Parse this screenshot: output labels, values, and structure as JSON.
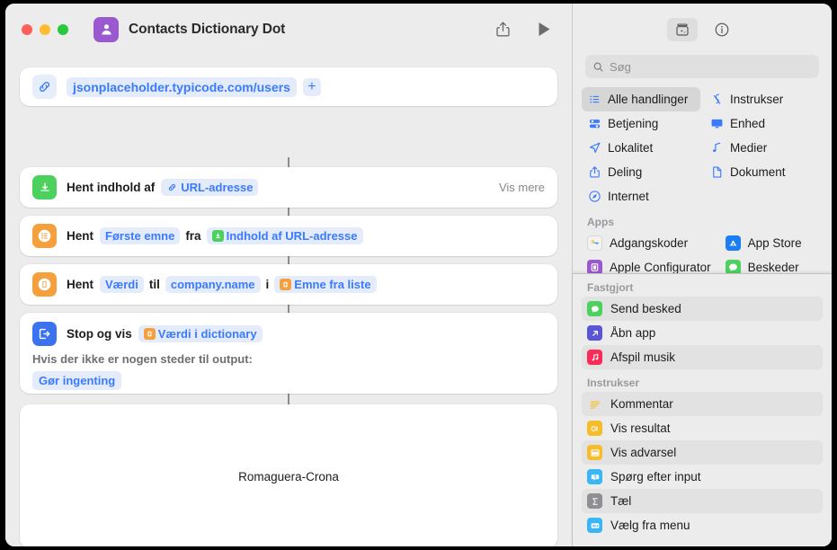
{
  "window": {
    "title": "Contacts Dictionary Dot",
    "app_icon": "contacts-person-icon",
    "traffic_lights": [
      "close",
      "minimize",
      "zoom"
    ],
    "toolbar": {
      "share_label": "share-icon",
      "run_label": "play-icon"
    }
  },
  "editor": {
    "url_action": {
      "icon": "link-icon",
      "url": "jsonplaceholder.typicode.com/users",
      "add_label": "+"
    },
    "actions": [
      {
        "icon": "download-content-icon",
        "title": "Hent indhold af",
        "token": "URL-adresse",
        "token_icon": "link-icon",
        "trailing": "Vis mere"
      },
      {
        "icon": "list-icon",
        "title": "Hent",
        "param1": "Første emne",
        "connector": "fra",
        "token": "Indhold af URL-adresse",
        "token_icon": "download-content-icon"
      },
      {
        "icon": "dictionary-icon",
        "title": "Hent",
        "param1": "Værdi",
        "connector1": "til",
        "param2": "company.name",
        "connector2": "i",
        "token": "Emne fra liste",
        "token_icon": "dictionary-icon"
      }
    ],
    "stop_action": {
      "icon": "stop-and-output-icon",
      "title": "Stop og vis",
      "token": "Værdi i dictionary",
      "token_icon": "dictionary-icon",
      "sub_label": "Hvis der ikke er nogen steder til output:",
      "sub_value": "Gør ingenting"
    },
    "result": {
      "text": "Romaguera-Crona"
    }
  },
  "sidebar": {
    "toolbar": {
      "library_icon": "action-library-icon",
      "info_icon": "info-circle-icon"
    },
    "search": {
      "placeholder": "Søg",
      "value": "",
      "icon": "search-icon"
    },
    "categories": [
      {
        "label": "Alle handlinger",
        "icon": "list-bullet-icon",
        "selected": true
      },
      {
        "label": "Instrukser",
        "icon": "scripting-icon",
        "selected": false
      },
      {
        "label": "Betjening",
        "icon": "controls-icon",
        "selected": false
      },
      {
        "label": "Enhed",
        "icon": "display-icon",
        "selected": false
      },
      {
        "label": "Lokalitet",
        "icon": "location-arrow-icon",
        "selected": false
      },
      {
        "label": "Medier",
        "icon": "music-note-icon",
        "selected": false
      },
      {
        "label": "Deling",
        "icon": "share-icon",
        "selected": false
      },
      {
        "label": "Dokument",
        "icon": "document-icon",
        "selected": false
      },
      {
        "label": "Internet",
        "icon": "safari-compass-icon",
        "selected": false
      }
    ],
    "apps_header": "Apps",
    "apps": [
      {
        "label": "Adgangskoder",
        "icon": "passwords-app-icon"
      },
      {
        "label": "App Store",
        "icon": "app-store-icon"
      },
      {
        "label": "Apple Configurator",
        "icon": "apple-configurator-icon"
      },
      {
        "label": "Beskeder",
        "icon": "messages-app-icon"
      }
    ],
    "pinned_header": "Fastgjort",
    "pinned": [
      {
        "label": "Send besked",
        "icon": "messages-app-icon",
        "color": "#4cd15f",
        "alt": true
      },
      {
        "label": "Åbn app",
        "icon": "open-app-icon",
        "color": "#5856d6",
        "alt": false
      },
      {
        "label": "Afspil musik",
        "icon": "music-app-icon",
        "color": "#fa2b56",
        "alt": true
      }
    ],
    "scripting_header": "Instrukser",
    "scripting": [
      {
        "label": "Kommentar",
        "icon": "comment-icon",
        "color": "#f5bc2c",
        "alt": true
      },
      {
        "label": "Vis resultat",
        "icon": "show-result-icon",
        "color": "#f5bc2c",
        "alt": false
      },
      {
        "label": "Vis advarsel",
        "icon": "show-alert-icon",
        "color": "#f5bc2c",
        "alt": true
      },
      {
        "label": "Spørg efter input",
        "icon": "ask-input-icon",
        "color": "#3ab6f5",
        "alt": false
      },
      {
        "label": "Tæl",
        "icon": "count-sigma-icon",
        "color": "#8e8e93",
        "alt": true
      },
      {
        "label": "Vælg fra menu",
        "icon": "choose-menu-icon",
        "color": "#3ab6f5",
        "alt": false
      }
    ]
  },
  "colors": {
    "accent_blue": "#3a7afe",
    "green": "#4cd15f",
    "orange": "#f5a03c",
    "purple": "#9b59d0",
    "window_bg": "#ececec"
  }
}
